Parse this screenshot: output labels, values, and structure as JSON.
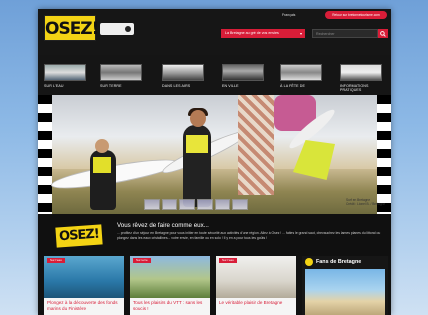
{
  "header": {
    "logo_text": "OSEZ!",
    "language": "Français",
    "cta": "Retour sur bretonnetourisme.com",
    "slogan_select": "La Bretagne au gré de vos envies",
    "search_placeholder": "Rechercher"
  },
  "nav": {
    "items": [
      {
        "label": "SUR L'EAU"
      },
      {
        "label": "SUR TERRE"
      },
      {
        "label": "DANS LES AIRS"
      },
      {
        "label": "EN VILLE"
      },
      {
        "label": "À LA FÊTE DE"
      },
      {
        "label": "INFORMATIONS PRATIQUES"
      }
    ]
  },
  "hero": {
    "caption_line1": "Surf en Bretagne",
    "caption_line2": "Crédit : Lionel B. / Bretagne"
  },
  "teaser": {
    "logo_text": "OSEZ!",
    "title": "Vous rêvez de faire comme eux...",
    "text": "... profitez d'un séjour en Bretagne pour vous initier en toute sécurité aux activités d'une région. Allez à Osez ! ... faites le grand saut, chevauchez les lames planes du littoral ou plongez dans les eaux cristallines... votre envie, en famille ou en solo ! Il y en a pour tous les goûts !"
  },
  "cards": [
    {
      "badge": "Sur l'eau",
      "title": "Plongez à la découverte des fonds marins du Finistère"
    },
    {
      "badge": "Sur terre",
      "title": "Tous les plaisirs du VTT : sans les soucis !"
    },
    {
      "badge": "Sur l'eau",
      "title": "Le véritable plaisir de Bretagne"
    }
  ],
  "fans": {
    "title": "Fans de Bretagne"
  },
  "colors": {
    "accent": "#d81d38",
    "brand_yellow": "#f3d314",
    "page_dark": "#111111"
  }
}
